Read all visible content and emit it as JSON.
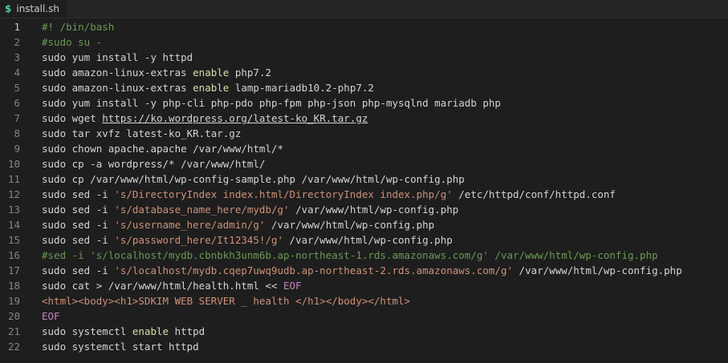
{
  "tab": {
    "icon": "dollar-terminal-icon",
    "label": "install.sh"
  },
  "active_line": 1,
  "lines": [
    {
      "n": "1",
      "tokens": [
        {
          "t": "#! /bin/bash",
          "c": "comment"
        }
      ]
    },
    {
      "n": "2",
      "tokens": [
        {
          "t": "#sudo su -",
          "c": "comment"
        }
      ]
    },
    {
      "n": "3",
      "tokens": [
        {
          "t": "sudo yum install -y httpd",
          "c": "plain"
        }
      ]
    },
    {
      "n": "4",
      "tokens": [
        {
          "t": "sudo amazon-linux-extras ",
          "c": "plain"
        },
        {
          "t": "enable",
          "c": "keyword"
        },
        {
          "t": " php7.2",
          "c": "plain"
        }
      ]
    },
    {
      "n": "5",
      "tokens": [
        {
          "t": "sudo amazon-linux-extras ",
          "c": "plain"
        },
        {
          "t": "enable",
          "c": "keyword"
        },
        {
          "t": " lamp-mariadb10.2-php7.2",
          "c": "plain"
        }
      ]
    },
    {
      "n": "6",
      "tokens": [
        {
          "t": "sudo yum install -y php-cli php-pdo php-fpm php-json php-mysqlnd mariadb php",
          "c": "plain"
        }
      ]
    },
    {
      "n": "7",
      "tokens": [
        {
          "t": "sudo wget ",
          "c": "plain"
        },
        {
          "t": "https://ko.wordpress.org/latest-ko_KR.tar.gz",
          "c": "link"
        }
      ]
    },
    {
      "n": "8",
      "tokens": [
        {
          "t": "sudo tar xvfz latest-ko_KR.tar.gz",
          "c": "plain"
        }
      ]
    },
    {
      "n": "9",
      "tokens": [
        {
          "t": "sudo chown apache.apache /var/www/html/*",
          "c": "plain"
        }
      ]
    },
    {
      "n": "10",
      "tokens": [
        {
          "t": "sudo cp -a wordpress/* /var/www/html/",
          "c": "plain"
        }
      ]
    },
    {
      "n": "11",
      "tokens": [
        {
          "t": "sudo cp /var/www/html/wp-config-sample.php /var/www/html/wp-config.php",
          "c": "plain"
        }
      ]
    },
    {
      "n": "12",
      "tokens": [
        {
          "t": "sudo sed -i ",
          "c": "plain"
        },
        {
          "t": "'s/DirectoryIndex index.html/DirectoryIndex index.php/g'",
          "c": "string"
        },
        {
          "t": " /etc/httpd/conf/httpd.conf",
          "c": "plain"
        }
      ]
    },
    {
      "n": "13",
      "tokens": [
        {
          "t": "sudo sed -i ",
          "c": "plain"
        },
        {
          "t": "'s/database_name_here/mydb/g'",
          "c": "string"
        },
        {
          "t": " /var/www/html/wp-config.php",
          "c": "plain"
        }
      ]
    },
    {
      "n": "14",
      "tokens": [
        {
          "t": "sudo sed -i ",
          "c": "plain"
        },
        {
          "t": "'s/username_here/admin/g'",
          "c": "string"
        },
        {
          "t": " /var/www/html/wp-config.php",
          "c": "plain"
        }
      ]
    },
    {
      "n": "15",
      "tokens": [
        {
          "t": "sudo sed -i ",
          "c": "plain"
        },
        {
          "t": "'s/password_here/It12345!/g'",
          "c": "string"
        },
        {
          "t": " /var/www/html/wp-config.php",
          "c": "plain"
        }
      ]
    },
    {
      "n": "16",
      "tokens": [
        {
          "t": "#sed -i 's/localhost/mydb.cbnbkh3unm6b.ap-northeast-1.rds.amazonaws.com/g' /var/www/html/wp-config.php",
          "c": "comment"
        }
      ]
    },
    {
      "n": "17",
      "tokens": [
        {
          "t": "sudo sed -i ",
          "c": "plain"
        },
        {
          "t": "'s/localhost/mydb.cqep7uwq9udb.ap-northeast-2.rds.amazonaws.com/g'",
          "c": "string"
        },
        {
          "t": " /var/www/html/wp-config.php",
          "c": "plain"
        }
      ]
    },
    {
      "n": "18",
      "tokens": [
        {
          "t": "sudo cat > /var/www/html/health.html << ",
          "c": "plain"
        },
        {
          "t": "EOF",
          "c": "eof"
        }
      ]
    },
    {
      "n": "19",
      "tokens": [
        {
          "t": "<html><body><h1>SDKIM WEB SERVER _ health </h1></body></html>",
          "c": "heredoc"
        }
      ]
    },
    {
      "n": "20",
      "tokens": [
        {
          "t": "EOF",
          "c": "eof"
        }
      ]
    },
    {
      "n": "21",
      "tokens": [
        {
          "t": "sudo systemctl ",
          "c": "plain"
        },
        {
          "t": "enable",
          "c": "keyword"
        },
        {
          "t": " httpd",
          "c": "plain"
        }
      ]
    },
    {
      "n": "22",
      "tokens": [
        {
          "t": "sudo systemctl start httpd",
          "c": "plain"
        }
      ]
    }
  ]
}
